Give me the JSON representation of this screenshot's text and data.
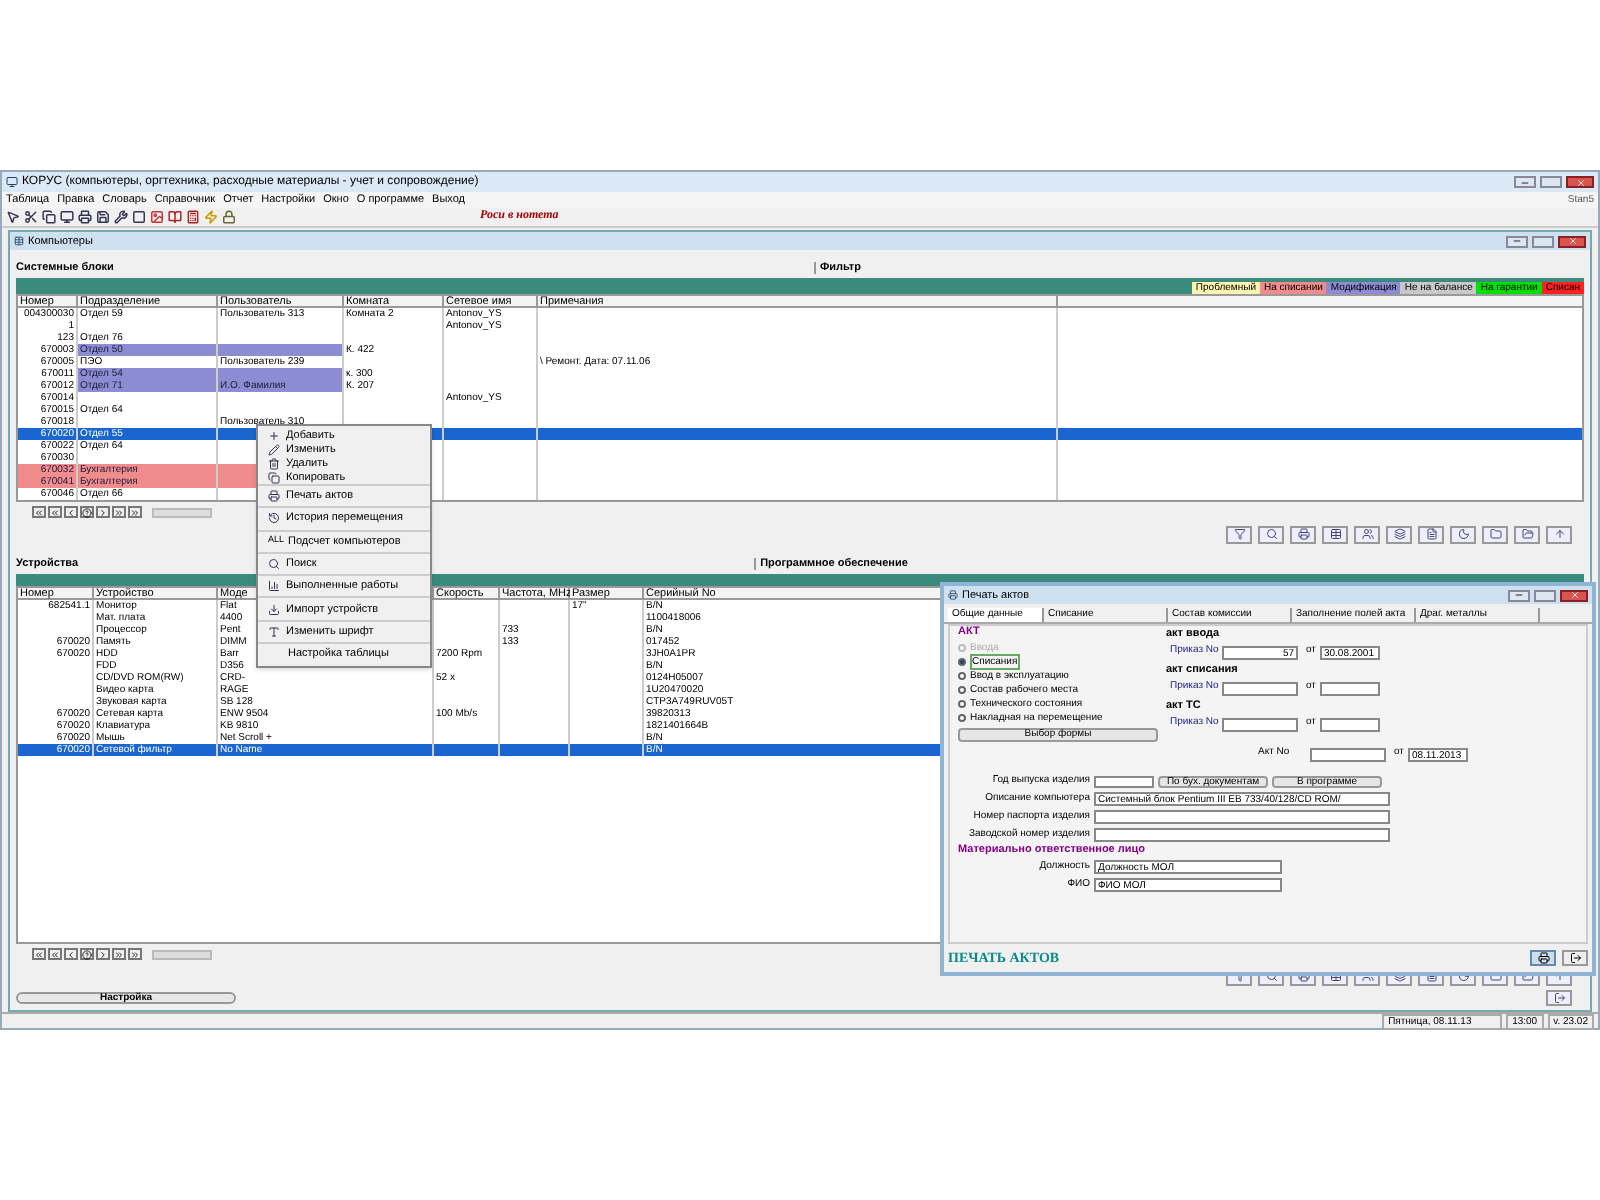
{
  "window": {
    "title": "КОРУС (компьютеры, оргтехника, расходные материалы - учет и сопровождение)"
  },
  "menu": [
    "Таблица",
    "Правка",
    "Словарь",
    "Справочник",
    "Отчет",
    "Настройки",
    "Окно",
    "О программе",
    "Выход"
  ],
  "user": "Stan5",
  "toolbar_caption": "Роси в нотета",
  "child_window": {
    "title": "Компьютеры"
  },
  "upper": {
    "title": "Системные блоки",
    "filter_label": "Фильтр",
    "legend": [
      {
        "label": "Проблемный",
        "color": "#fff3b0"
      },
      {
        "label": "На списании",
        "color": "#f08c8c"
      },
      {
        "label": "Модификация",
        "color": "#8c8cd2"
      },
      {
        "label": "Не на балансе",
        "color": "#c8c8c8"
      },
      {
        "label": "На гарантии",
        "color": "#00e000"
      },
      {
        "label": "Списан",
        "color": "#ff2020"
      }
    ],
    "columns": [
      "Номер",
      "Подразделение",
      "Пользователь",
      "Комната",
      "Сетевое имя",
      "Примечания"
    ],
    "rows": [
      {
        "selected": false,
        "cells": [
          "004300030",
          "Отдел 59",
          "Пользователь 313",
          "Комната 2",
          "Antonov_YS",
          null
        ]
      },
      {
        "selected": false,
        "cells": [
          "1",
          null,
          null,
          null,
          "Antonov_YS",
          null
        ]
      },
      {
        "selected": false,
        "cells": [
          "123",
          "Отдел 76",
          null,
          null,
          null,
          null
        ]
      },
      {
        "selected": false,
        "color": "#8c8cd2",
        "cells": [
          "670003",
          "Отдел 50",
          null,
          "К. 422",
          null,
          null
        ]
      },
      {
        "selected": false,
        "cells": [
          "670005",
          "ПЭО",
          "Пользователь 239",
          null,
          null,
          "\\ Ремонт. Дата: 07.11.06"
        ]
      },
      {
        "selected": false,
        "color": "#8c8cd2",
        "cells": [
          "670011",
          "Отдел 54",
          null,
          "к. 300",
          null,
          null
        ]
      },
      {
        "selected": false,
        "color": "#8c8cd2",
        "cells": [
          "670012",
          "Отдел 71",
          "И.О. Фамилия",
          "К. 207",
          null,
          null
        ]
      },
      {
        "selected": false,
        "cells": [
          "670014",
          null,
          null,
          null,
          "Antonov_YS",
          null
        ]
      },
      {
        "selected": false,
        "cells": [
          "670015",
          "Отдел 64",
          null,
          null,
          null,
          null
        ]
      },
      {
        "selected": false,
        "cells": [
          "670018",
          null,
          "Пользователь 310",
          null,
          null,
          null
        ]
      },
      {
        "selected": true,
        "cells": [
          "670020",
          "Отдел 55",
          null,
          null,
          null,
          null
        ]
      },
      {
        "selected": false,
        "cells": [
          "670022",
          "Отдел 64",
          null,
          null,
          null,
          null
        ]
      },
      {
        "selected": false,
        "cells": [
          "670030",
          null,
          null,
          null,
          null,
          null
        ]
      },
      {
        "selected": false,
        "color": "#f08c8c",
        "cells": [
          "670032",
          "Бухгалтерия",
          null,
          null,
          null,
          null
        ]
      },
      {
        "selected": false,
        "color": "#f08c8c",
        "cells": [
          "670041",
          "Бухгалтерия",
          null,
          null,
          null,
          null
        ]
      },
      {
        "selected": false,
        "cells": [
          "670046",
          "Отдел 66",
          null,
          null,
          null,
          null
        ]
      }
    ]
  },
  "lower": {
    "title": "Устройства",
    "software_label": "Программное обеспечение",
    "columns": [
      "Номер",
      "Устройство",
      "Моде",
      "Скорость",
      "Частота, MHz",
      "Размер",
      "Серийный No"
    ],
    "rows": [
      {
        "selected": false,
        "cells": [
          "682541.1",
          "Монитор",
          "Flat",
          null,
          null,
          "17\"",
          "B/N"
        ]
      },
      {
        "selected": false,
        "cells": [
          null,
          "Мат. плата",
          "4400",
          null,
          null,
          null,
          "1100418006"
        ]
      },
      {
        "selected": false,
        "cells": [
          null,
          "Процессор",
          "Pent",
          null,
          "733",
          null,
          "B/N"
        ]
      },
      {
        "selected": false,
        "cells": [
          "670020",
          "Память",
          "DIMM",
          null,
          "133",
          null,
          "017452"
        ]
      },
      {
        "selected": false,
        "cells": [
          "670020",
          "HDD",
          "Barr",
          "7200 Rpm",
          null,
          null,
          "3JH0A1PR"
        ]
      },
      {
        "selected": false,
        "cells": [
          null,
          "FDD",
          "D356",
          null,
          null,
          null,
          "B/N"
        ]
      },
      {
        "selected": false,
        "cells": [
          null,
          "CD/DVD ROM(RW)",
          "CRD-",
          "52 x",
          null,
          null,
          "0124H05007"
        ]
      },
      {
        "selected": false,
        "cells": [
          null,
          "Видео карта",
          "RAGE",
          null,
          null,
          null,
          "1U20470020"
        ]
      },
      {
        "selected": false,
        "cells": [
          null,
          "Звуковая карта",
          "SB 128",
          null,
          null,
          null,
          "CTP3A749RUV05T"
        ]
      },
      {
        "selected": false,
        "cells": [
          "670020",
          "Сетевая карта",
          "ENW 9504",
          "100 Mb/s",
          null,
          null,
          "39820313"
        ]
      },
      {
        "selected": false,
        "cells": [
          "670020",
          "Клавиатура",
          "KB 9810",
          null,
          null,
          null,
          "1821401664B"
        ]
      },
      {
        "selected": false,
        "cells": [
          "670020",
          "Мышь",
          "Net Scroll +",
          null,
          null,
          null,
          "B/N"
        ]
      },
      {
        "selected": true,
        "cells": [
          "670020",
          "Сетевой фильтр",
          "No Name",
          null,
          null,
          null,
          "B/N"
        ]
      }
    ]
  },
  "settings_tab": "Настройка",
  "context_menu": [
    [
      {
        "label": "Добавить"
      },
      {
        "label": "Изменить"
      },
      {
        "label": "Удалить"
      },
      {
        "label": "Копировать"
      }
    ],
    [
      {
        "label": "Печать актов"
      }
    ],
    [
      {
        "label": "История перемещения"
      }
    ],
    [
      {
        "label": "Подсчет компьютеров",
        "glyph": "ALL"
      }
    ],
    [
      {
        "label": "Поиск"
      }
    ],
    [
      {
        "label": "Выполненные работы"
      }
    ],
    [
      {
        "label": "Импорт устройств"
      }
    ],
    [
      {
        "label": "Изменить шрифт"
      }
    ],
    [
      {
        "label": "Настройка таблицы"
      }
    ]
  ],
  "dialog": {
    "title": "Печать актов",
    "tabs": [
      {
        "label": "Общие данные",
        "selected": true
      },
      {
        "label": "Списание",
        "selected": false
      },
      {
        "label": "Состав комиссии",
        "selected": false
      },
      {
        "label": "Заполнение полей акта",
        "selected": false
      },
      {
        "label": "Драг. металлы",
        "selected": false
      }
    ],
    "act_title": "АКТ",
    "acts": [
      {
        "label": "Ввода",
        "selected": false,
        "disabled": true
      },
      {
        "label": "Списания",
        "selected": true,
        "disabled": false
      },
      {
        "label": "Ввод в эксплуатацию",
        "selected": false,
        "disabled": false
      },
      {
        "label": "Состав рабочего места",
        "selected": false,
        "disabled": false
      },
      {
        "label": "Технического состояния",
        "selected": false,
        "disabled": false
      },
      {
        "label": "Накладная на перемещение",
        "selected": false,
        "disabled": false
      }
    ],
    "choose_form": "Выбор формы",
    "orders": [
      {
        "title": "акт ввода",
        "order_label": "Приказ No",
        "order": "57",
        "from_label": "от",
        "date": "30.08.2001"
      },
      {
        "title": "акт списания",
        "order_label": "Приказ No",
        "from_label": "от"
      },
      {
        "title": "акт ТС",
        "order_label": "Приказ No",
        "from_label": "от"
      }
    ],
    "act_no": {
      "label": "Акт No",
      "from_label": "от",
      "date": "08.11.2013"
    },
    "year_label": "Год выпуска изделия",
    "year_buttons": [
      "По бух. документам",
      "В программе"
    ],
    "fields": [
      {
        "label": "Описание компьютера",
        "value": "Системный блок Pentium III EB 733/40/128/CD ROM/"
      },
      {
        "label": "Номер паспорта изделия"
      },
      {
        "label": "Заводской номер изделия"
      }
    ],
    "mol_title": "Материально ответственное лицо",
    "mol_fields": [
      {
        "label": "Должность",
        "value": "Должность МОЛ"
      },
      {
        "label": "ФИО",
        "value": "ФИО МОЛ"
      }
    ],
    "footer": "ПЕЧАТЬ АКТОВ"
  },
  "status_bar": {
    "date": "Пятница, 08.11.13",
    "time": "13:00",
    "version": "v. 23.02"
  }
}
